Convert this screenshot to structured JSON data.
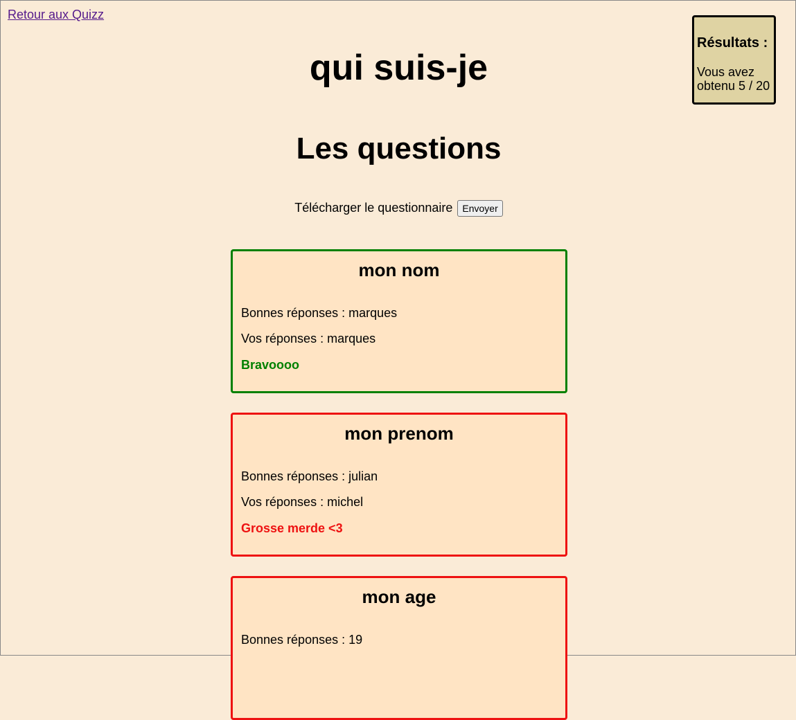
{
  "nav": {
    "back_label": "Retour aux Quizz"
  },
  "results": {
    "title": "Résultats :",
    "text": "Vous avez obtenu 5 / 20"
  },
  "page": {
    "title": "qui suis-je",
    "section_title": "Les questions"
  },
  "download": {
    "label": "Télécharger le questionnaire",
    "button_label": "Envoyer"
  },
  "questions": [
    {
      "title": "mon nom",
      "correct_line": "Bonnes réponses : marques",
      "answer_line": "Vos réponses : marques",
      "verdict": "Bravoooo",
      "status_color": "#008000"
    },
    {
      "title": "mon prenom",
      "correct_line": "Bonnes réponses : julian",
      "answer_line": "Vos réponses : michel",
      "verdict": "Grosse merde <3",
      "status_color": "#ee1111"
    },
    {
      "title": "mon age",
      "correct_line": "Bonnes réponses : 19",
      "answer_line": "",
      "verdict": "",
      "status_color": "#ee1111"
    }
  ],
  "colors": {
    "background": "#faebd7",
    "card_background": "#ffe4c4",
    "results_background": "#dfd3a3",
    "correct": "#008000",
    "incorrect": "#ee1111",
    "link": "#551a8b"
  }
}
